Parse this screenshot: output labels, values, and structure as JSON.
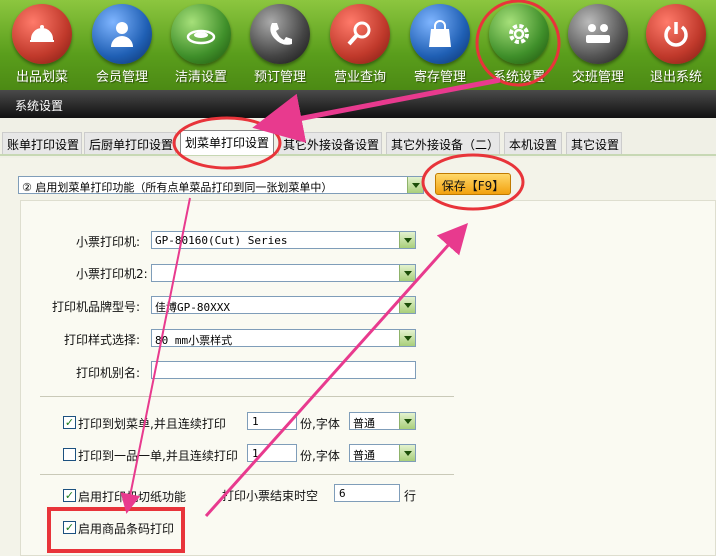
{
  "toolbar": {
    "items": [
      {
        "label": "出品划菜",
        "icon": "cloche-icon",
        "color": "#c0392b"
      },
      {
        "label": "会员管理",
        "icon": "user-icon",
        "color": "#1f5fb4"
      },
      {
        "label": "洁清设置",
        "icon": "plate-icon",
        "color": "#3f8f2a"
      },
      {
        "label": "预订管理",
        "icon": "phone-icon",
        "color": "#444444"
      },
      {
        "label": "营业查询",
        "icon": "search-icon",
        "color": "#c0392b"
      },
      {
        "label": "寄存管理",
        "icon": "bag-icon",
        "color": "#1f5fb4"
      },
      {
        "label": "系统设置",
        "icon": "gear-icon",
        "color": "#3f8f2a"
      },
      {
        "label": "交班管理",
        "icon": "people-icon",
        "color": "#555555"
      },
      {
        "label": "退出系统",
        "icon": "power-icon",
        "color": "#c0392b"
      }
    ]
  },
  "subbar": {
    "title": "系统设置"
  },
  "tabs": [
    {
      "label": "账单打印设置"
    },
    {
      "label": "后厨单打印设置"
    },
    {
      "label": "划菜单打印设置",
      "active": true
    },
    {
      "label": "其它外接设备设置"
    },
    {
      "label": "其它外接设备（二）"
    },
    {
      "label": "本机设置"
    },
    {
      "label": "其它设置"
    }
  ],
  "form": {
    "mode_select": "② 启用划菜单打印功能（所有点单菜品打印到同一张划菜单中）",
    "save_button": "保存【F9】",
    "printer_label": "小票打印机:",
    "printer_value": "GP-80160(Cut) Series",
    "printer2_label": "小票打印机2:",
    "printer2_value": "",
    "brand_label": "打印机品牌型号:",
    "brand_value": "佳博GP-80XXX",
    "style_label": "打印样式选择:",
    "style_value": "80  mm小票样式",
    "alias_label": "打印机别名:",
    "alias_value": "",
    "print_to_list_label": "打印到划菜单,并且连续打印",
    "print_to_list_checked": true,
    "print_to_list_copies": "1",
    "copies_font_label_1": "份,字体",
    "font_value_1": "普通",
    "print_one_label": "打印到一品一单,并且连续打印",
    "print_one_checked": false,
    "print_one_copies": "1",
    "copies_font_label_2": "份,字体",
    "font_value_2": "普通",
    "cut_label": "启用打印机切纸功能",
    "cut_checked": true,
    "end_blank_label": "打印小票结束时空",
    "end_blank_value": "6",
    "end_blank_unit": "行",
    "barcode_label": "启用商品条码打印",
    "barcode_checked": true
  },
  "annotations": {
    "color": "#e83a8e",
    "circle_color": "#e8343a"
  }
}
